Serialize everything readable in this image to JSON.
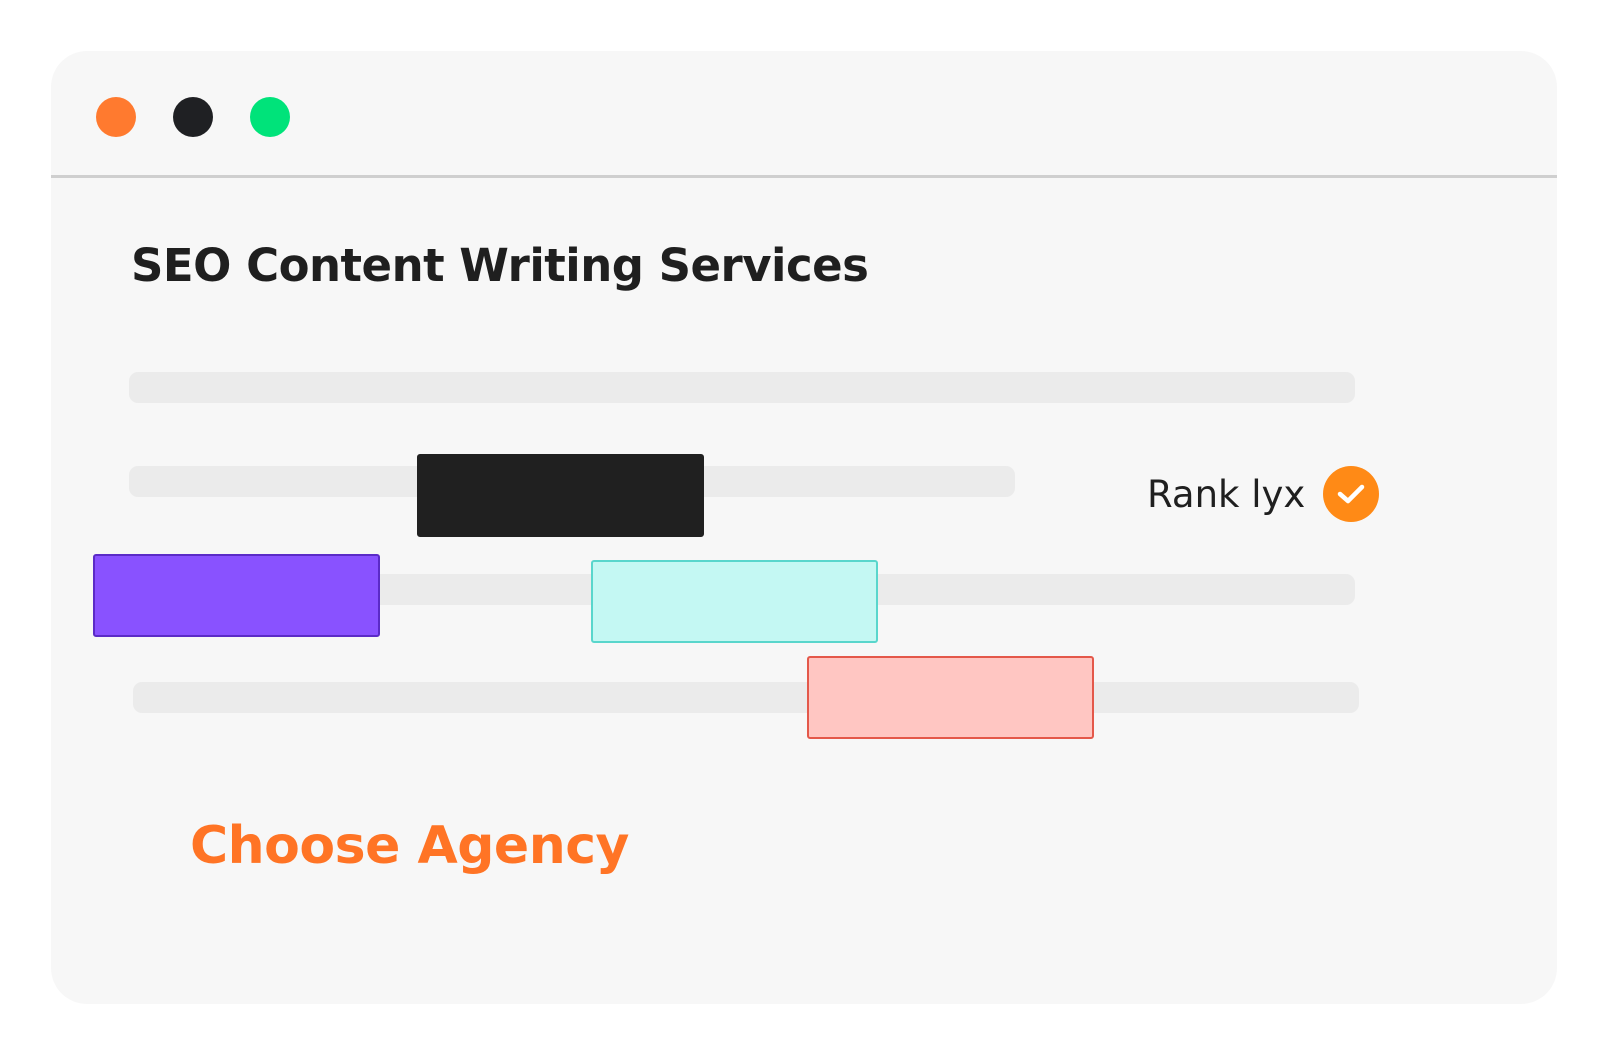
{
  "window": {
    "controls": [
      {
        "name": "close",
        "color": "#ff7a2f"
      },
      {
        "name": "minimize",
        "color": "#1f2023"
      },
      {
        "name": "maximize",
        "color": "#00e37a"
      }
    ]
  },
  "main": {
    "title": "SEO Content Writing Services",
    "brand": {
      "name": "Rank lyx",
      "badge_icon": "check-circle-icon",
      "badge_color": "#ff8a16"
    },
    "blocks": [
      {
        "name": "black",
        "fill": "#202020",
        "border": "#202020"
      },
      {
        "name": "purple",
        "fill": "#8952ff",
        "border": "#5b2bc7"
      },
      {
        "name": "cyan",
        "fill": "#c4f8f3",
        "border": "#59d6cc"
      },
      {
        "name": "pink",
        "fill": "#ffc6c2",
        "border": "#e4584a"
      }
    ],
    "cta": {
      "label": "Choose Agency",
      "color": "#ff7425"
    }
  }
}
